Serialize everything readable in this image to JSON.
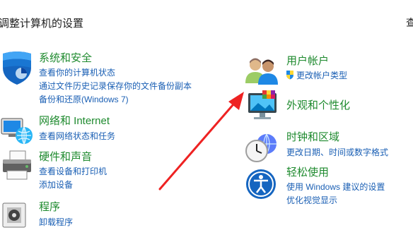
{
  "header": {
    "title": "调整计算机的设置",
    "view_by": "查"
  },
  "left_categories": [
    {
      "title": "系统和安全",
      "links": [
        "查看你的计算机状态",
        "通过文件历史记录保存你的文件备份副本",
        "备份和还原(Windows 7)"
      ]
    },
    {
      "title": "网络和 Internet",
      "links": [
        "查看网络状态和任务"
      ]
    },
    {
      "title": "硬件和声音",
      "links": [
        "查看设备和打印机",
        "添加设备"
      ]
    },
    {
      "title": "程序",
      "links": [
        "卸载程序"
      ]
    }
  ],
  "right_categories": [
    {
      "title": "用户帐户",
      "links": [
        "更改帐户类型"
      ]
    },
    {
      "title": "外观和个性化",
      "links": []
    },
    {
      "title": "时钟和区域",
      "links": [
        "更改日期、时间或数字格式"
      ]
    },
    {
      "title": "轻松使用",
      "links": [
        "使用 Windows 建议的设置",
        "优化视觉显示"
      ]
    }
  ],
  "annotation": {
    "arrow_color": "#ee2222"
  },
  "colors": {
    "category": "#1e8a2e",
    "link": "#1a5fb4",
    "text": "#1e1e1e"
  }
}
